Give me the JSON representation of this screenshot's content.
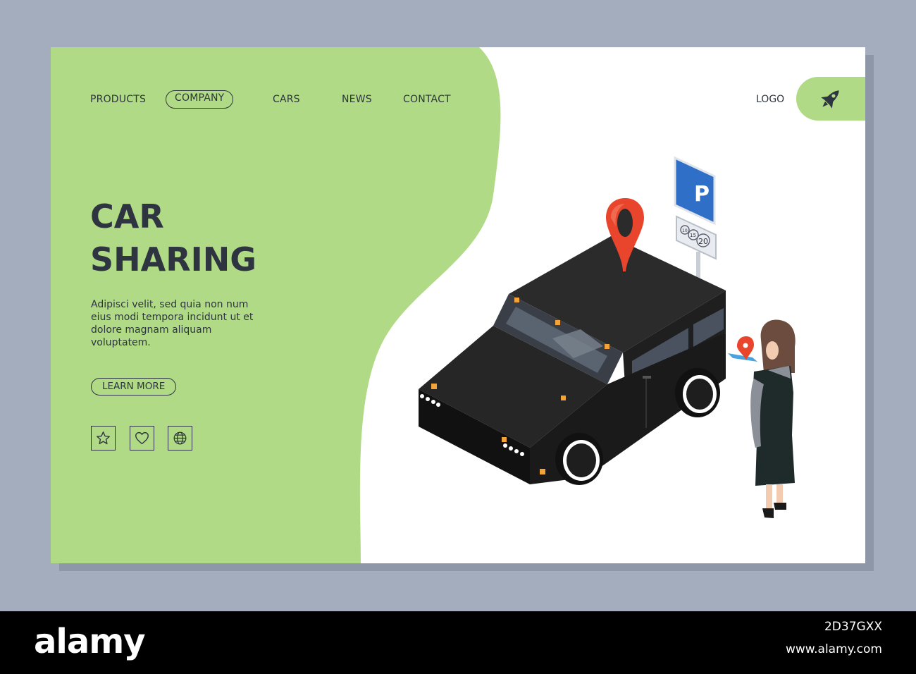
{
  "nav": {
    "items": [
      {
        "label": "PRODUCTS"
      },
      {
        "label": "COMPANY",
        "active": true
      },
      {
        "label": "CARS"
      },
      {
        "label": "NEWS"
      },
      {
        "label": "CONTACT"
      }
    ],
    "logo_label": "LOGO",
    "logo_icon": "rocket-icon"
  },
  "hero": {
    "title_line1": "CAR",
    "title_line2": "SHARING",
    "description": "Adipisci velit, sed quia non num eius modi tempora incidunt ut et dolore magnam aliquam voluptatem.",
    "button_label": "LEARN MORE"
  },
  "social_icons": [
    "star-icon",
    "heart-icon",
    "globe-icon"
  ],
  "parking_sign": {
    "letter": "P",
    "sub_numbers": [
      "10",
      "15",
      "20"
    ]
  },
  "colors": {
    "accent_green": "#b0da86",
    "text_dark": "#2e3540",
    "background": "#a4adbd",
    "pin_red": "#e8452c"
  },
  "watermark": {
    "brand": "alamy",
    "image_id": "2D37GXX",
    "url": "www.alamy.com"
  }
}
